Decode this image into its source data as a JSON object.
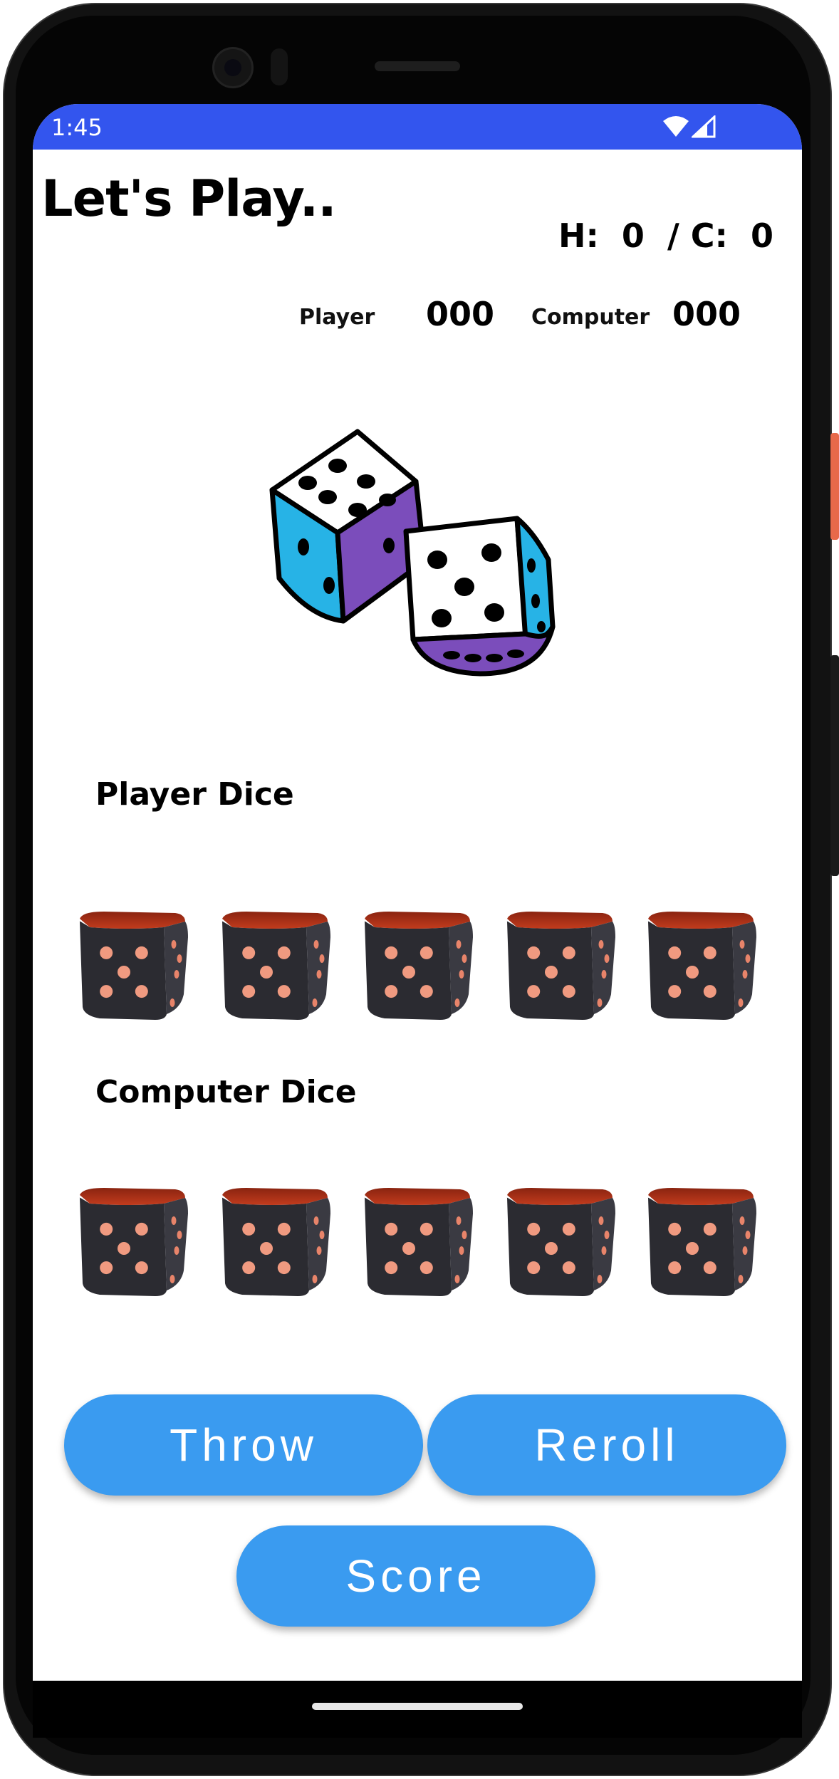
{
  "status_bar": {
    "time": "1:45",
    "color": "#3355ee"
  },
  "header": {
    "title": "Let's Play..",
    "scoreline": "H:  0  / C:  0"
  },
  "scores": {
    "player_label": "Player",
    "player_value": "000",
    "computer_label": "Computer",
    "computer_value": "000"
  },
  "hero_image": {
    "icon": "dice-pair-illustration"
  },
  "player_section": {
    "title": "Player Dice",
    "dice": [
      5,
      5,
      5,
      5,
      5
    ]
  },
  "computer_section": {
    "title": "Computer Dice",
    "dice": [
      5,
      5,
      5,
      5,
      5
    ]
  },
  "buttons": {
    "throw": "Throw",
    "reroll": "Reroll",
    "score": "Score",
    "color": "#3a9bf0"
  }
}
